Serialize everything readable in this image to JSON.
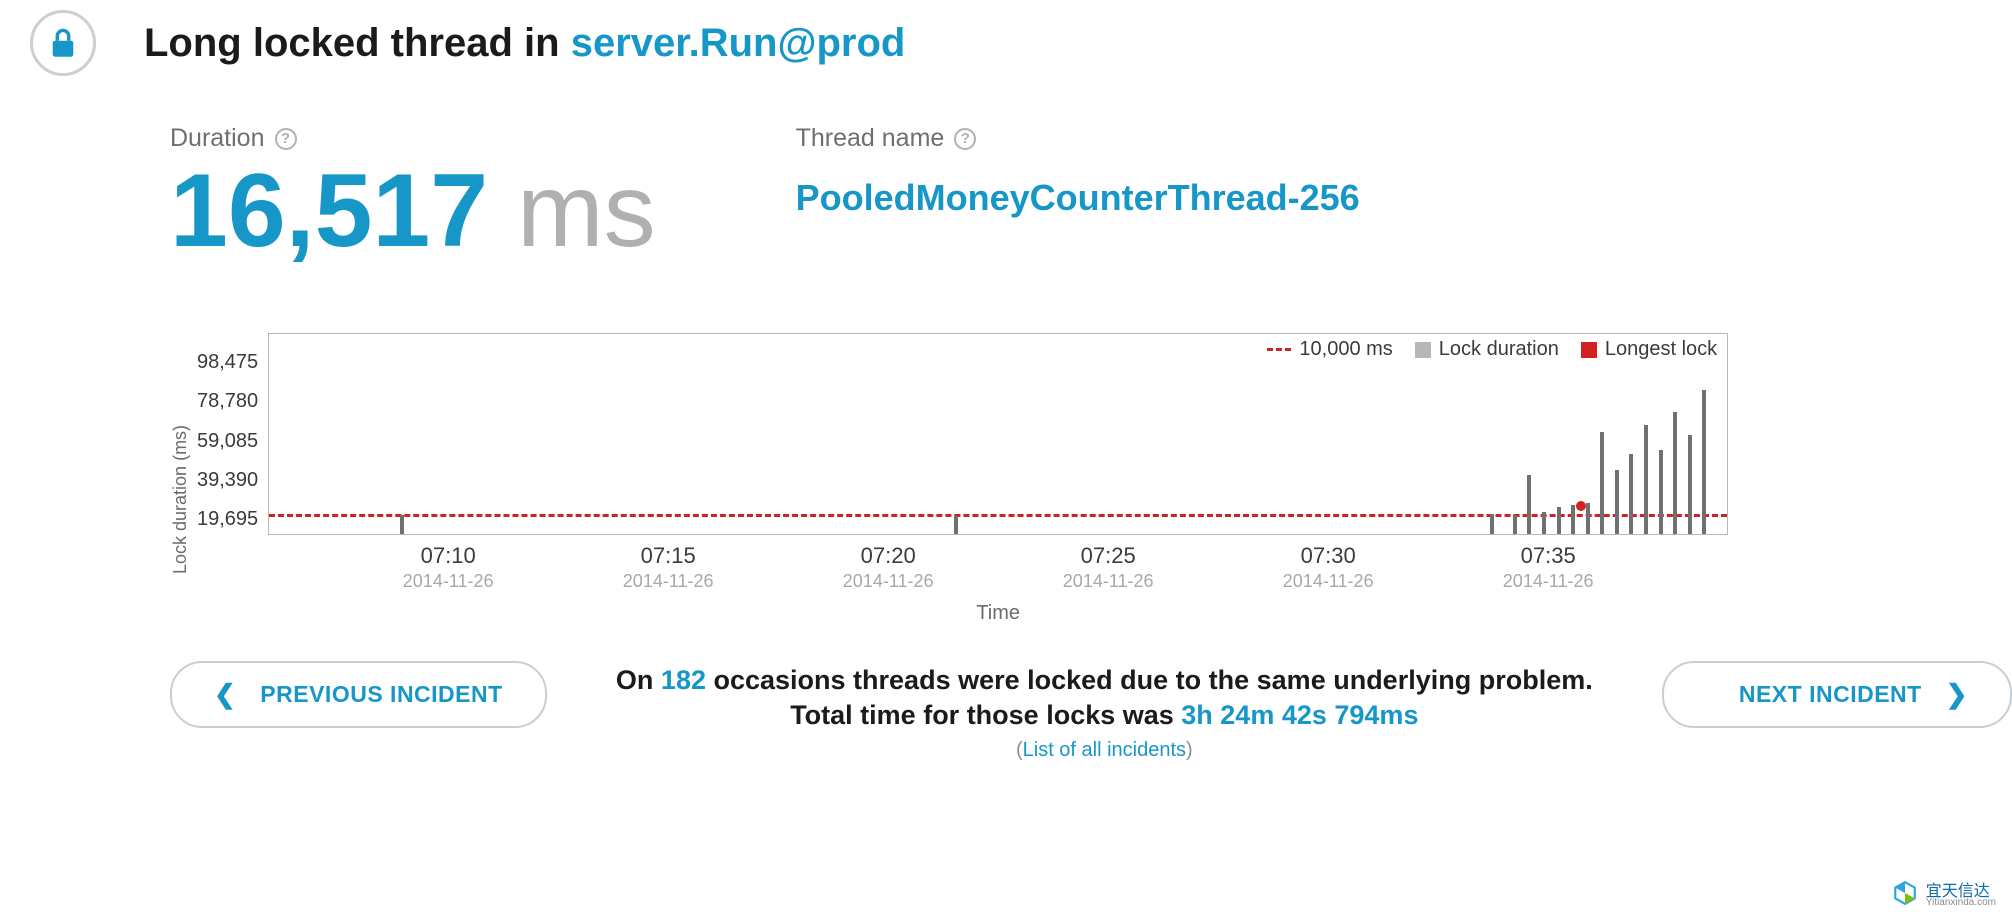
{
  "title": {
    "prefix": "Long locked thread in ",
    "link_text": "server.Run@prod"
  },
  "metrics": {
    "duration_label": "Duration",
    "duration_value": "16,517",
    "duration_unit": " ms",
    "thread_label": "Thread name",
    "thread_name": "PooledMoneyCounterThread-256"
  },
  "chart_data": {
    "type": "bar",
    "title": "",
    "xlabel": "Time",
    "ylabel": "Lock duration (ms)",
    "ylim": [
      0,
      118170
    ],
    "y_ticks": [
      "98,475",
      "78,780",
      "59,085",
      "39,390",
      "19,695"
    ],
    "x_ticks": [
      {
        "time": "07:10",
        "date": "2014-11-26"
      },
      {
        "time": "07:15",
        "date": "2014-11-26"
      },
      {
        "time": "07:20",
        "date": "2014-11-26"
      },
      {
        "time": "07:25",
        "date": "2014-11-26"
      },
      {
        "time": "07:30",
        "date": "2014-11-26"
      },
      {
        "time": "07:35",
        "date": "2014-11-26"
      }
    ],
    "threshold": {
      "value": 10000,
      "label": "10,000 ms"
    },
    "series": [
      {
        "name": "Lock duration",
        "color": "#b6b6b6"
      },
      {
        "name": "Longest lock",
        "color": "#d32121"
      }
    ],
    "longest_lock": {
      "x_pct": 90.0,
      "value": 16517
    },
    "bars": [
      {
        "x_pct": 9.0,
        "value": 11200
      },
      {
        "x_pct": 47.0,
        "value": 11000
      },
      {
        "x_pct": 83.7,
        "value": 12000
      },
      {
        "x_pct": 85.3,
        "value": 11500
      },
      {
        "x_pct": 86.3,
        "value": 35000
      },
      {
        "x_pct": 87.3,
        "value": 13000
      },
      {
        "x_pct": 88.3,
        "value": 16000
      },
      {
        "x_pct": 89.3,
        "value": 17500
      },
      {
        "x_pct": 90.3,
        "value": 18500
      },
      {
        "x_pct": 91.3,
        "value": 61000
      },
      {
        "x_pct": 92.3,
        "value": 38000
      },
      {
        "x_pct": 93.3,
        "value": 48000
      },
      {
        "x_pct": 94.3,
        "value": 65000
      },
      {
        "x_pct": 95.3,
        "value": 50000
      },
      {
        "x_pct": 96.3,
        "value": 73000
      },
      {
        "x_pct": 97.3,
        "value": 59000
      },
      {
        "x_pct": 98.3,
        "value": 86000
      }
    ]
  },
  "nav": {
    "previous_label": "PREVIOUS INCIDENT",
    "next_label": "NEXT INCIDENT"
  },
  "summary": {
    "line1_a": "On ",
    "line1_count": "182",
    "line1_b": " occasions threads were locked due to the same underlying problem. Total time for those locks was ",
    "total_time": "3h 24m 42s 794ms",
    "list_link_pre": "(",
    "list_link": "List of all incidents",
    "list_link_post": ")"
  },
  "watermark": {
    "text": "宜天信达",
    "sub": "Yitianxinda.com"
  }
}
